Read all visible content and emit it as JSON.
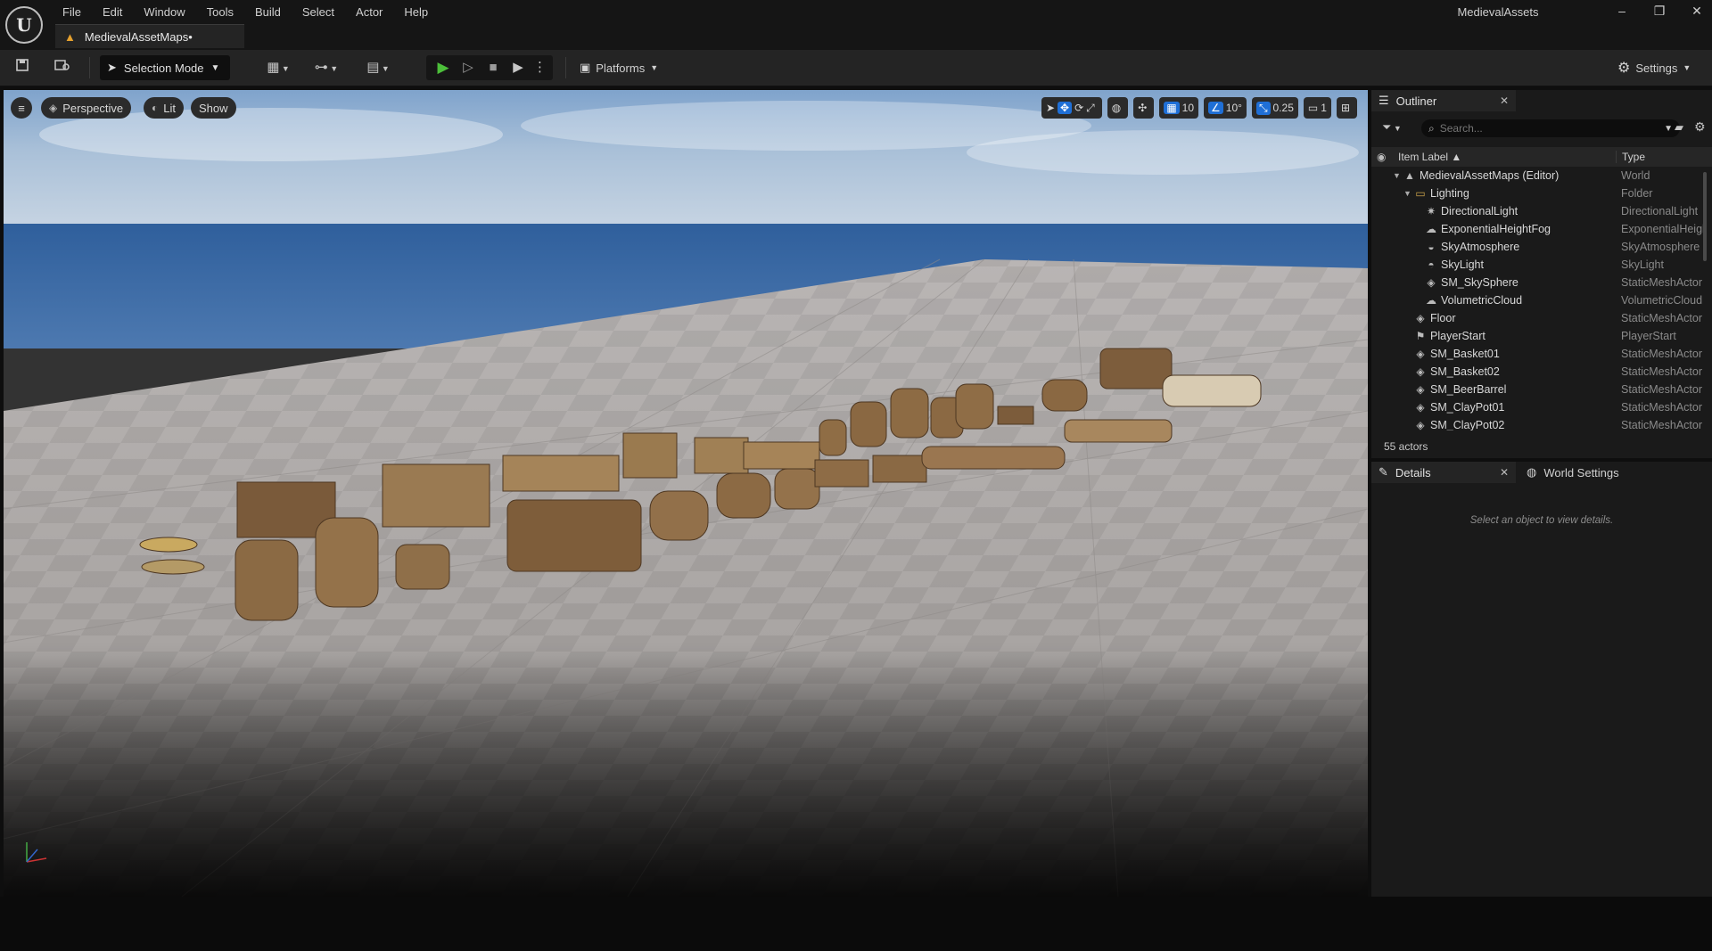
{
  "app": {
    "project_name": "MedievalAssets",
    "logo_letter": "U",
    "document_tab": "MedievalAssetMaps•"
  },
  "menu": [
    "File",
    "Edit",
    "Window",
    "Tools",
    "Build",
    "Select",
    "Actor",
    "Help"
  ],
  "toolbar": {
    "selection_mode": "Selection Mode",
    "platforms": "Platforms",
    "settings": "Settings"
  },
  "viewport": {
    "perspective": "Perspective",
    "lit": "Lit",
    "show": "Show",
    "grid_snap": "10",
    "rotation_snap": "10°",
    "scale_snap": "0.25",
    "camera_speed": "1"
  },
  "outliner": {
    "tab_label": "Outliner",
    "search_placeholder": "Search...",
    "col_label": "Item Label ▲",
    "col_type": "Type",
    "actor_count": "55 actors",
    "rows": [
      {
        "label": "MedievalAssetMaps (Editor)",
        "type": "World",
        "indent": 0,
        "arrow": true,
        "icon": "world-icon"
      },
      {
        "label": "Lighting",
        "type": "Folder",
        "indent": 1,
        "arrow": true,
        "icon": "folder-icon"
      },
      {
        "label": "DirectionalLight",
        "type": "DirectionalLight",
        "indent": 2,
        "arrow": false,
        "icon": "directional-light-icon"
      },
      {
        "label": "ExponentialHeightFog",
        "type": "ExponentialHeightFog",
        "indent": 2,
        "arrow": false,
        "icon": "fog-icon"
      },
      {
        "label": "SkyAtmosphere",
        "type": "SkyAtmosphere",
        "indent": 2,
        "arrow": false,
        "icon": "sky-atmosphere-icon"
      },
      {
        "label": "SkyLight",
        "type": "SkyLight",
        "indent": 2,
        "arrow": false,
        "icon": "skylight-icon"
      },
      {
        "label": "SM_SkySphere",
        "type": "StaticMeshActor",
        "indent": 2,
        "arrow": false,
        "icon": "static-mesh-icon"
      },
      {
        "label": "VolumetricCloud",
        "type": "VolumetricCloud",
        "indent": 2,
        "arrow": false,
        "icon": "cloud-icon"
      },
      {
        "label": "Floor",
        "type": "StaticMeshActor",
        "indent": 1,
        "arrow": false,
        "icon": "static-mesh-icon"
      },
      {
        "label": "PlayerStart",
        "type": "PlayerStart",
        "indent": 1,
        "arrow": false,
        "icon": "player-start-icon"
      },
      {
        "label": "SM_Basket01",
        "type": "StaticMeshActor",
        "indent": 1,
        "arrow": false,
        "icon": "static-mesh-icon"
      },
      {
        "label": "SM_Basket02",
        "type": "StaticMeshActor",
        "indent": 1,
        "arrow": false,
        "icon": "static-mesh-icon"
      },
      {
        "label": "SM_BeerBarrel",
        "type": "StaticMeshActor",
        "indent": 1,
        "arrow": false,
        "icon": "static-mesh-icon"
      },
      {
        "label": "SM_ClayPot01",
        "type": "StaticMeshActor",
        "indent": 1,
        "arrow": false,
        "icon": "static-mesh-icon"
      },
      {
        "label": "SM_ClayPot02",
        "type": "StaticMeshActor",
        "indent": 1,
        "arrow": false,
        "icon": "static-mesh-icon"
      }
    ]
  },
  "details": {
    "tab_label": "Details",
    "world_settings_label": "World Settings",
    "empty_message": "Select an object to view details."
  },
  "colors": {
    "play_green": "#4cbf3a",
    "accent_blue": "#1f6fd6",
    "tab_orange": "#e6a12e"
  }
}
